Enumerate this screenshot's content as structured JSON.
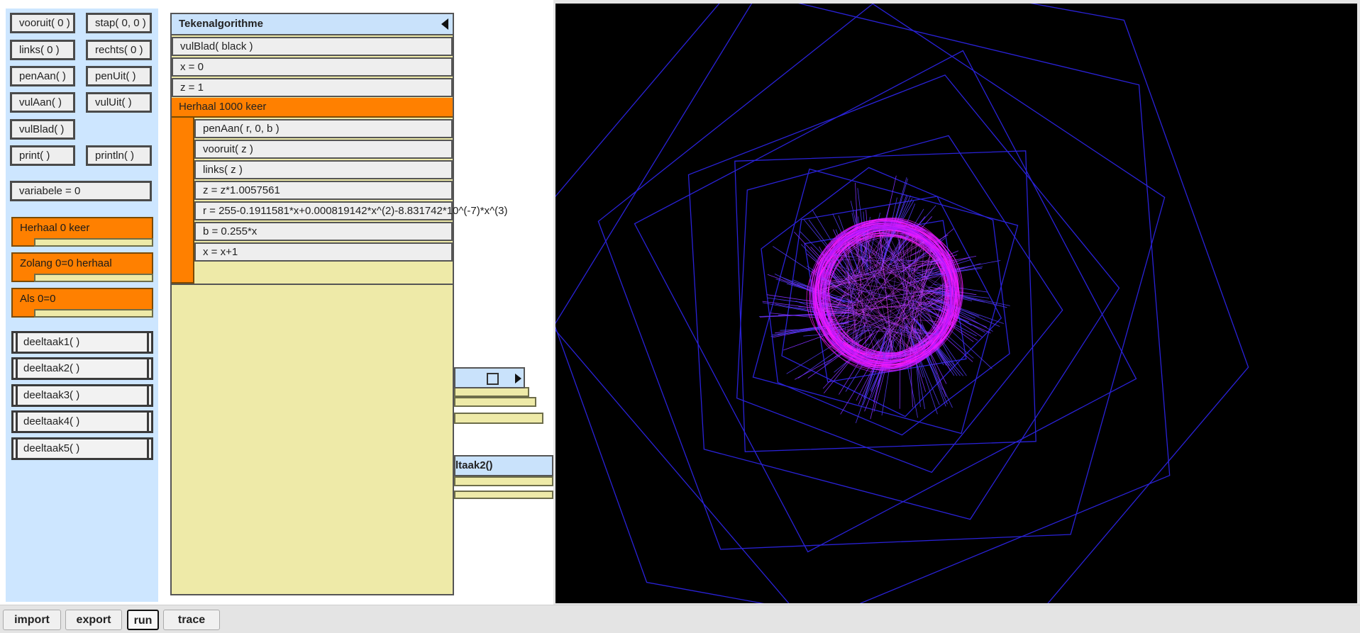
{
  "palette": {
    "vooruit": "vooruit( 0 )",
    "stap": "stap( 0, 0 )",
    "links": "links( 0 )",
    "rechts": "rechts( 0 )",
    "penaan": "penAan(  )",
    "penuit": "penUit(  )",
    "vulaan": "vulAan(  )",
    "vuluit": "vulUit(  )",
    "vulblad": "vulBlad(  )",
    "print": "print(  )",
    "println": "println(  )",
    "variabele": "variabele = 0",
    "herhaal": "Herhaal 0 keer",
    "zolang": "Zolang 0=0 herhaal",
    "als": "Als 0=0",
    "subtasks": [
      "deeltaak1(  )",
      "deeltaak2(  )",
      "deeltaak3(  )",
      "deeltaak4(  )",
      "deeltaak5(  )"
    ]
  },
  "algorithm": {
    "title": "Tekenalgorithme",
    "statements": [
      "vulBlad( black )",
      "x = 0",
      "z = 1"
    ],
    "loop": {
      "header": "Herhaal 1000 keer",
      "body": [
        "penAan( r, 0, b )",
        "vooruit( z )",
        "links( z )",
        "z = z*1.0057561",
        "r = 255-0.1911581*x+0.000819142*x^(2)-8.831742*10^(-7)*x^(3)",
        "b = 0.255*x",
        "x = x+1"
      ]
    }
  },
  "task_window": {
    "title": "ltaak2()"
  },
  "toolbar": {
    "import": "import",
    "export": "export",
    "run": "run",
    "trace": "trace"
  },
  "colors": {
    "accent_orange": "#ff8000",
    "header_blue": "#c9e2fb",
    "palette_bg": "#cde6ff",
    "canvas_bg": "#000000",
    "line_blue": "#2a22d8",
    "line_magenta": "#ff1aff"
  }
}
